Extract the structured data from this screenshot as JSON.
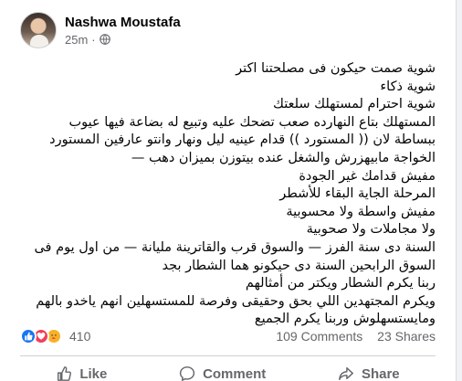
{
  "post": {
    "author": "Nashwa Moustafa",
    "time": "25m",
    "separator": "·",
    "lines": [
      "شوية صمت   حيكون فى مصلحتنا اكتر",
      "شوية ذكاء",
      "شوية احترام لمستهلك سلعتك",
      "المستهلك بتاع النهارده صعب تضحك عليه وتبيع له بضاعة فيها عيوب",
      "ببساطة لان (( المستورد )) قدام عينيه ليل ونهار وانتو عارفين المستورد",
      "الخواجة مابيهزرش والشغل عنده بيتوزن بميزان دهب —",
      "مفيش قدامك غير الجودة",
      "المرحلة الجاية البقاء للأشطر",
      "مفيش واسطة ولا محسوبية",
      "ولا مجاملات ولا صحوبية",
      "السنة دى سنة الفرز  —  والسوق قرب والقاترينة مليانة  —  من اول يوم فى",
      "السوق  الرابحين السنة دى حيكونو هما الشطار بجد",
      "ربنا يكرم الشطار ويكتر من أمثالهم",
      "ويكرم المجتهدين اللي بحق وحقيقى وفرصة للمستسهلين انهم ياخدو بالهم",
      "ومايستسهلوش    وربنا يكرم الجميع"
    ]
  },
  "stats": {
    "reaction_count": "410",
    "comments": "109 Comments",
    "shares": "23 Shares"
  },
  "actions": {
    "like": "Like",
    "comment": "Comment",
    "share": "Share"
  },
  "colors": {
    "like_blue": "#1877f2",
    "love_red": "#f33e58",
    "care_yellow": "#f7b125",
    "secondary_text": "#65676b"
  }
}
